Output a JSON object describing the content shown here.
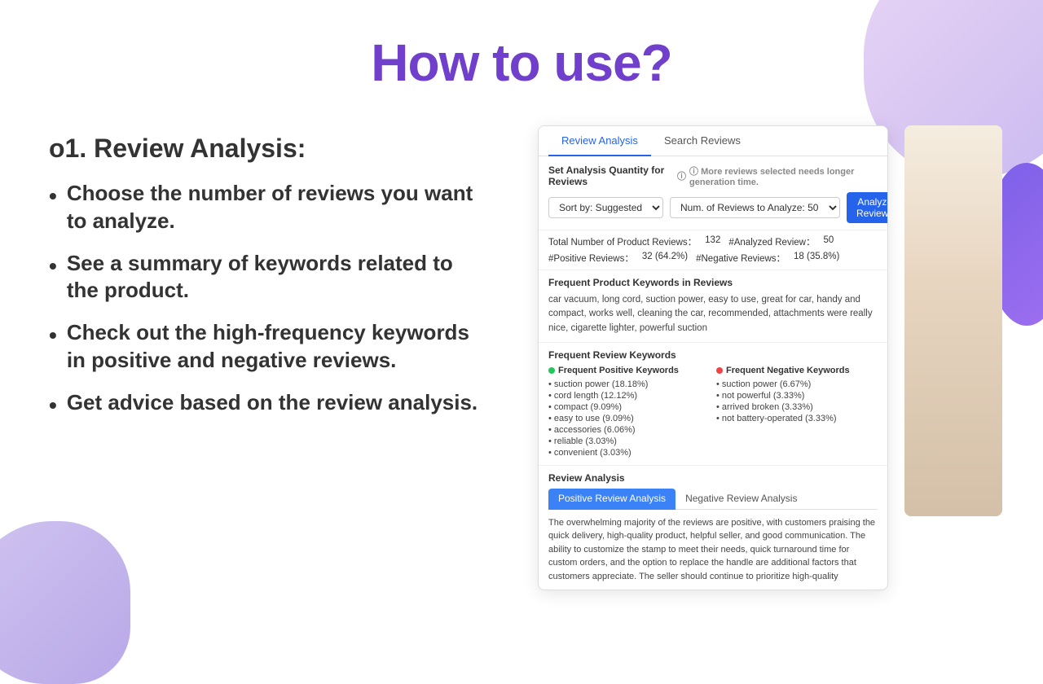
{
  "page": {
    "title": "How to use?",
    "background_blobs": true
  },
  "left_section": {
    "heading": "o1. Review Analysis:",
    "bullets": [
      "Choose the number of reviews you want to analyze.",
      "See a summary of keywords related to the product.",
      "Check out the high-frequency keywords in positive and negative reviews.",
      "Get advice based on the review analysis."
    ]
  },
  "ui_preview": {
    "tabs": [
      {
        "label": "Review Analysis",
        "active": true
      },
      {
        "label": "Search Reviews",
        "active": false
      }
    ],
    "analysis_quantity": {
      "label": "Set Analysis Quantity for Reviews",
      "hint": "ⓘ More reviews selected needs longer generation time.",
      "sort_label": "Sort by: Suggested",
      "num_label": "Num. of Reviews to Analyze:  50",
      "analyze_btn": "Analyze Reviews"
    },
    "stats": {
      "total_label": "Total Number of Product Reviews：",
      "total_value": "132",
      "analyzed_label": "#Analyzed Review：",
      "analyzed_value": "50",
      "positive_label": "#Positive Reviews：",
      "positive_value": "32 (64.2%)",
      "negative_label": "#Negative Reviews：",
      "negative_value": "18 (35.8%)"
    },
    "frequent_product_keywords": {
      "title": "Frequent Product Keywords in Reviews",
      "text": "car vacuum, long cord, suction power, easy to use, great for car, handy and compact, works well, cleaning the car, recommended, attachments were really nice, cigarette lighter, powerful suction"
    },
    "frequent_review_keywords": {
      "title": "Frequent Review Keywords",
      "positive_title": "Frequent Positive Keywords",
      "positive_items": [
        "• suction power (18.18%)",
        "• cord length (12.12%)",
        "• compact (9.09%)",
        "• easy to use (9.09%)",
        "• accessories (6.06%)",
        "• reliable (3.03%)",
        "• convenient (3.03%)"
      ],
      "negative_title": "Frequent Negative Keywords",
      "negative_items": [
        "• suction power (6.67%)",
        "• not powerful (3.33%)",
        "• arrived broken (3.33%)",
        "• not battery-operated (3.33%)"
      ]
    },
    "review_analysis": {
      "section_title": "Review Analysis",
      "inner_tabs": [
        {
          "label": "Positive Review Analysis",
          "active": true
        },
        {
          "label": "Negative Review Analysis",
          "active": false
        }
      ],
      "text": "The overwhelming majority of the reviews are positive, with customers praising the quick delivery, high-quality product, helpful seller, and good communication. The ability to customize the stamp to meet their needs, quick turnaround time for custom orders, and the option to replace the handle are additional factors that customers appreciate. The seller should continue to prioritize high-quality"
    }
  }
}
